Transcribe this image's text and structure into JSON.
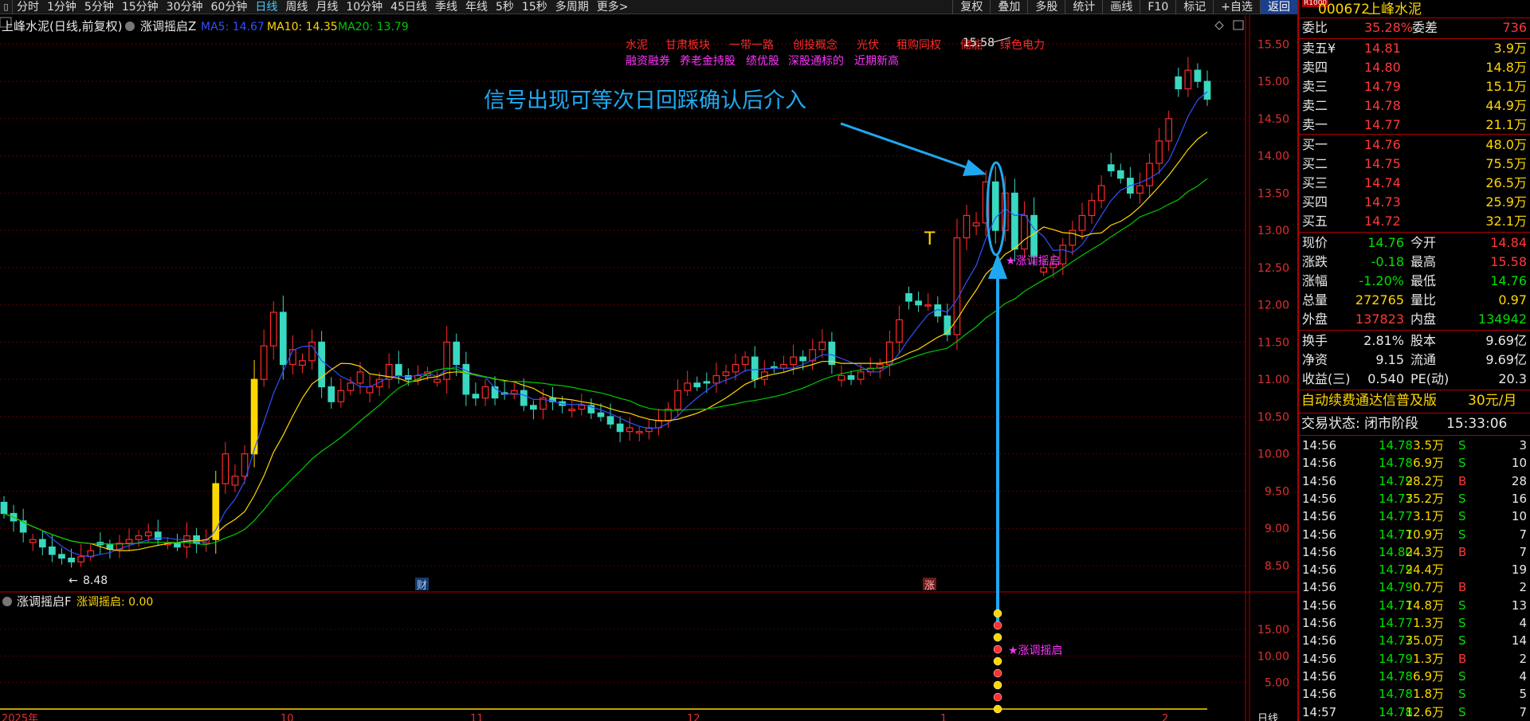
{
  "menu": {
    "tabs": [
      "分时",
      "1分钟",
      "5分钟",
      "15分钟",
      "30分钟",
      "60分钟",
      "日线",
      "周线",
      "月线",
      "10分钟",
      "45日线",
      "季线",
      "年线",
      "5秒",
      "15秒",
      "多周期",
      "更多>"
    ],
    "active": "日线",
    "right": [
      "复权",
      "叠加",
      "多股",
      "统计",
      "画线",
      "F10",
      "标记",
      "+自选",
      "返回"
    ]
  },
  "stock": {
    "code": "000672",
    "name": "上峰水泥",
    "badge": "R1000"
  },
  "chart_header": {
    "title": "上峰水泥(日线,前复权)",
    "indicator": "涨调摇启Z",
    "ma5": "MA5: 14.67",
    "ma10": "MA10: 14.35",
    "ma20": "MA20: 13.79"
  },
  "tags": {
    "line1": [
      "水泥",
      "甘肃板块",
      "一带一路",
      "创投概念",
      "光伏",
      "租购同权",
      "储能",
      "绿色电力"
    ],
    "line2": [
      "融资融券",
      "养老金持股",
      "绩优股",
      "深股通标的",
      "近期新高"
    ]
  },
  "annotation": "信号出现可等次日回踩确认后介入",
  "labels": {
    "high": "15.58",
    "low": "8.48",
    "cai": "财",
    "zhang": "涨",
    "signal_main": "★涨调摇启",
    "signal_sub": "★涨调摇启"
  },
  "sub": {
    "name": "涨调摇启F",
    "series_label": "涨调摇启: 0.00",
    "yticks": [
      "15.00",
      "10.00",
      "5.00"
    ]
  },
  "xaxis": {
    "labels": [
      "2025年",
      "10",
      "11",
      "12",
      "1",
      "2"
    ],
    "period": "日线"
  },
  "price_axis": [
    "15.50",
    "15.00",
    "14.50",
    "14.00",
    "13.50",
    "13.00",
    "12.50",
    "12.00",
    "11.50",
    "11.00",
    "10.50",
    "10.00",
    "9.50",
    "9.00",
    "8.50"
  ],
  "colors": {
    "up": "#ff2a2a",
    "down": "#39d8c0",
    "ma5": "#ffffff",
    "ma10": "#ffd700",
    "ma20": "#00c800",
    "grid": "#5a0000",
    "annot": "#1fa8f0",
    "signal": "#ff33ff"
  },
  "wei": {
    "wb_label": "委比",
    "wb": "35.28%",
    "wc_label": "委差",
    "wc": "736"
  },
  "asks": [
    {
      "l": "卖五¥",
      "p": "14.81",
      "v": "3.9万"
    },
    {
      "l": "卖四",
      "p": "14.80",
      "v": "14.8万"
    },
    {
      "l": "卖三",
      "p": "14.79",
      "v": "15.1万"
    },
    {
      "l": "卖二",
      "p": "14.78",
      "v": "44.9万"
    },
    {
      "l": "卖一",
      "p": "14.77",
      "v": "21.1万"
    }
  ],
  "bids": [
    {
      "l": "买一",
      "p": "14.76",
      "v": "48.0万"
    },
    {
      "l": "买二",
      "p": "14.75",
      "v": "75.5万"
    },
    {
      "l": "买三",
      "p": "14.74",
      "v": "26.5万"
    },
    {
      "l": "买四",
      "p": "14.73",
      "v": "25.9万"
    },
    {
      "l": "买五",
      "p": "14.72",
      "v": "32.1万"
    }
  ],
  "quote": [
    {
      "l1": "现价",
      "v1": "14.76",
      "c1": "grn",
      "l2": "今开",
      "v2": "14.84",
      "c2": "red"
    },
    {
      "l1": "涨跌",
      "v1": "-0.18",
      "c1": "grn",
      "l2": "最高",
      "v2": "15.58",
      "c2": "red"
    },
    {
      "l1": "涨幅",
      "v1": "-1.20%",
      "c1": "grn",
      "l2": "最低",
      "v2": "14.76",
      "c2": "grn"
    },
    {
      "l1": "总量",
      "v1": "272765",
      "c1": "yel",
      "l2": "量比",
      "v2": "0.97",
      "c2": "yel"
    },
    {
      "l1": "外盘",
      "v1": "137823",
      "c1": "red",
      "l2": "内盘",
      "v2": "134942",
      "c2": "grn"
    }
  ],
  "fund": [
    {
      "l1": "换手",
      "v1": "2.81%",
      "l2": "股本",
      "v2": "9.69亿"
    },
    {
      "l1": "净资",
      "v1": "9.15",
      "l2": "流通",
      "v2": "9.69亿"
    },
    {
      "l1": "收益(三)",
      "v1": "0.540",
      "l2": "PE(动)",
      "v2": "20.3"
    }
  ],
  "ad": {
    "text": "自动续费通达信普及版",
    "price": "30元/月"
  },
  "status": {
    "text": "交易状态: 闭市阶段",
    "time": "15:33:06"
  },
  "ticks": [
    {
      "t": "14:56",
      "p": "14.78",
      "v": "3.5万",
      "s": "S",
      "n": "3"
    },
    {
      "t": "14:56",
      "p": "14.78",
      "v": "6.9万",
      "s": "S",
      "n": "10"
    },
    {
      "t": "14:56",
      "p": "14.79",
      "v": "28.2万",
      "s": "B",
      "n": "28"
    },
    {
      "t": "14:56",
      "p": "14.77",
      "v": "35.2万",
      "s": "S",
      "n": "16"
    },
    {
      "t": "14:56",
      "p": "14.77",
      "v": "3.1万",
      "s": "S",
      "n": "10"
    },
    {
      "t": "14:56",
      "p": "14.77",
      "v": "10.9万",
      "s": "S",
      "n": "7"
    },
    {
      "t": "14:56",
      "p": "14.80",
      "v": "24.3万",
      "s": "B",
      "n": "7"
    },
    {
      "t": "14:56",
      "p": "14.79",
      "v": "24.4万",
      "s": "",
      "n": "19"
    },
    {
      "t": "14:56",
      "p": "14.79",
      "v": "0.7万",
      "s": "B",
      "n": "2"
    },
    {
      "t": "14:56",
      "p": "14.77",
      "v": "14.8万",
      "s": "S",
      "n": "13"
    },
    {
      "t": "14:56",
      "p": "14.77",
      "v": "1.3万",
      "s": "S",
      "n": "4"
    },
    {
      "t": "14:56",
      "p": "14.77",
      "v": "35.0万",
      "s": "S",
      "n": "14"
    },
    {
      "t": "14:56",
      "p": "14.79",
      "v": "1.3万",
      "s": "B",
      "n": "2"
    },
    {
      "t": "14:56",
      "p": "14.78",
      "v": "6.9万",
      "s": "S",
      "n": "4"
    },
    {
      "t": "14:56",
      "p": "14.78",
      "v": "1.8万",
      "s": "S",
      "n": "5"
    },
    {
      "t": "14:57",
      "p": "14.78",
      "v": "12.6万",
      "s": "S",
      "n": "7"
    }
  ],
  "chart_data": {
    "type": "candlestick",
    "y_range": [
      8.2,
      15.75
    ],
    "closes": [
      9.2,
      9.1,
      8.95,
      8.85,
      8.75,
      8.65,
      8.6,
      8.55,
      8.62,
      8.7,
      8.78,
      8.72,
      8.8,
      8.85,
      8.9,
      8.95,
      8.85,
      8.8,
      8.75,
      8.9,
      8.8,
      8.85,
      9.6,
      10.0,
      9.7,
      10.0,
      11.0,
      11.45,
      11.9,
      11.2,
      11.4,
      11.25,
      11.5,
      10.9,
      10.7,
      10.85,
      10.95,
      11.1,
      10.9,
      11.0,
      11.2,
      11.05,
      11.0,
      11.05,
      11.1,
      11.0,
      11.5,
      11.2,
      10.8,
      10.75,
      10.9,
      10.75,
      10.8,
      10.85,
      10.65,
      10.6,
      10.75,
      10.7,
      10.65,
      10.6,
      10.65,
      10.55,
      10.5,
      10.4,
      10.3,
      10.35,
      10.3,
      10.35,
      10.45,
      10.6,
      10.85,
      10.95,
      10.9,
      10.95,
      11.05,
      11.1,
      11.2,
      11.3,
      11.0,
      11.1,
      11.15,
      11.2,
      11.3,
      11.25,
      11.4,
      11.5,
      11.2,
      11.05,
      11.0,
      11.1,
      11.15,
      11.2,
      11.5,
      11.8,
      12.05,
      12.0,
      12.0,
      11.85,
      11.6,
      12.9,
      13.2,
      13.1,
      13.65,
      13.0,
      13.5,
      12.75,
      13.2,
      12.65,
      12.5,
      12.55,
      12.8,
      13.0,
      13.2,
      13.4,
      13.6,
      13.8,
      13.7,
      13.5,
      13.6,
      13.9,
      14.2,
      14.5,
      14.9,
      15.15,
      15.0,
      14.76
    ],
    "ma5_last": 14.67,
    "ma10_last": 14.35,
    "ma20_last": 13.79,
    "sub_y_range": [
      0,
      18
    ]
  }
}
